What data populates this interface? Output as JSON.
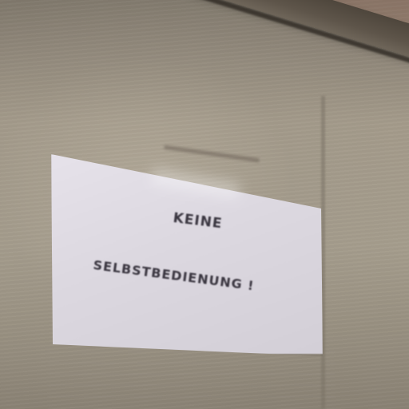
{
  "sign": {
    "line1": "KEINE",
    "line2": "SELBSTBEDIENUNG !"
  },
  "colors": {
    "wall": "#a59d8d",
    "beam": "#5e554a",
    "paper": "#dcd8e0",
    "ink": "#3a3640"
  }
}
